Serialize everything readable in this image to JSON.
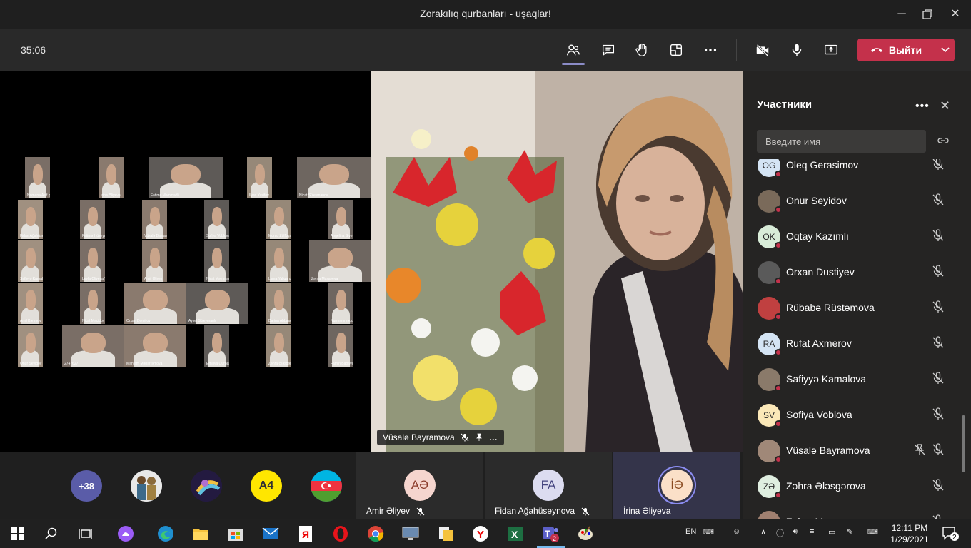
{
  "window": {
    "title": "Zorakılıq qurbanları - uşaqlar!"
  },
  "toolbar": {
    "timer": "35:06",
    "leave_label": "Выйти"
  },
  "share_tiles": [
    {
      "name": "Nəmanə Asif qızı"
    },
    {
      "name": "İrina Əliyeva"
    },
    {
      "name": "Fatimə Məmmədli"
    },
    {
      "name": "İlyas Yusifov"
    },
    {
      "name": "Nicat Süleymanov"
    },
    {
      "name": "Fidan Ağahüseynova"
    },
    {
      "name": "Fatimə Hüseynova"
    },
    {
      "name": "Vüsalə Bayramova"
    },
    {
      "name": "Sofiya Voblova"
    },
    {
      "name": "Murad Zülfüqarov"
    },
    {
      "name": "Angelina Sivenova"
    },
    {
      "name": "Səfiyyə Kamalova"
    },
    {
      "name": "Leyla Əliyeva Yusif qızı"
    },
    {
      "name": "Amir Əliyev"
    },
    {
      "name": "Nicat Məmmədov"
    },
    {
      "name": "Liana Yaliqarova"
    },
    {
      "name": "Zəhra Musayeva"
    },
    {
      "name": "Amil Kərimov"
    },
    {
      "name": "Nicat Məcidov"
    },
    {
      "name": "Orxan Dəmirov"
    },
    {
      "name": "Aysel Süleymanlı"
    },
    {
      "name": "Darina Abbasova"
    },
    {
      "name": "Nurməmmədov Elvin"
    },
    {
      "name": "Onur Seyidov"
    },
    {
      "name": "2747627"
    },
    {
      "name": "Məryəm Məhərrəmova"
    },
    {
      "name": "Emiliya Qurbanova"
    },
    {
      "name": "Zəhra Ələsgərova"
    },
    {
      "name": "Famin Babayev"
    }
  ],
  "main_video": {
    "name": "Vüsalə Bayramova"
  },
  "bottom_strip": {
    "overflow_count": "+38",
    "avatars": [
      {
        "name": "avatar-1",
        "color": "#e8e8e8"
      },
      {
        "name": "avatar-2",
        "color": "#6b4c9a"
      },
      {
        "name": "avatar-3",
        "color": "#ffe600",
        "text": "А4"
      },
      {
        "name": "avatar-4",
        "color": "#1e6cc8"
      }
    ],
    "tiles": [
      {
        "initials": "AƏ",
        "name": "Amir Əliyev",
        "color": "#f5d5ce"
      },
      {
        "initials": "FA",
        "name": "Fidan Ağahüseynova",
        "color": "#dcdcf0"
      },
      {
        "initials": "İƏ",
        "name": "İrina Əliyeva",
        "color": "#fbe0c8"
      }
    ]
  },
  "panel": {
    "title": "Участники",
    "search_placeholder": "Введите имя",
    "participants": [
      {
        "name": "Oleq Gerasimov",
        "initials": "OG",
        "color": "#d4e4f4",
        "photo": false
      },
      {
        "name": "Onur Seyidov",
        "initials": "",
        "color": "#7a6a5a",
        "photo": true
      },
      {
        "name": "Oqtay Kazımlı",
        "initials": "OK",
        "color": "#d8ecd8",
        "photo": false
      },
      {
        "name": "Orxan Dustiyev",
        "initials": "",
        "color": "#5a5a5a",
        "photo": true
      },
      {
        "name": "Rübabə Rüstəmova",
        "initials": "",
        "color": "#c04040",
        "photo": true
      },
      {
        "name": "Rufat Axmerov",
        "initials": "RA",
        "color": "#d4e4f4",
        "photo": false
      },
      {
        "name": "Safiyyə Kamalova",
        "initials": "",
        "color": "#8a7a6a",
        "photo": true
      },
      {
        "name": "Sofiya Voblova",
        "initials": "SV",
        "color": "#fbe8b8",
        "photo": false
      },
      {
        "name": "Vüsalə Bayramova",
        "initials": "",
        "color": "#a08878",
        "photo": true
      },
      {
        "name": "Zəhra Ələsgərova",
        "initials": "ZƏ",
        "color": "#dfeee0",
        "photo": false
      },
      {
        "name": "Zəhra M",
        "initials": "",
        "color": "#a08070",
        "photo": true
      }
    ]
  },
  "taskbar": {
    "language": "EN",
    "time": "12:11 PM",
    "date": "1/29/2021",
    "notifications": "2",
    "teams_badge": "2"
  }
}
